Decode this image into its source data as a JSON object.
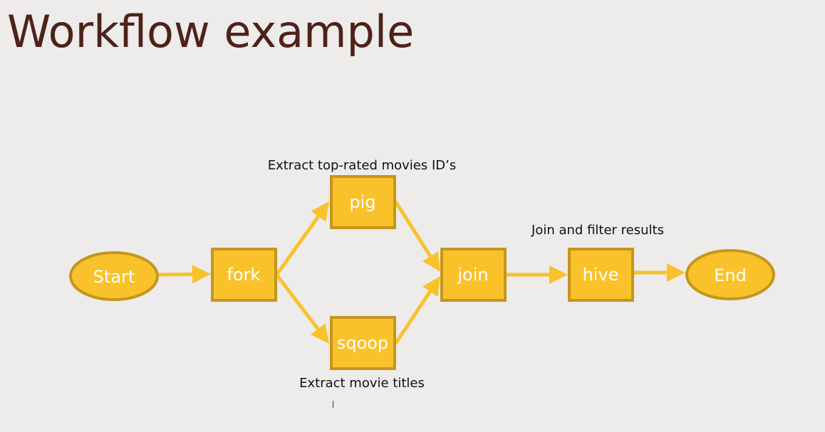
{
  "title": "Workflow example",
  "colors": {
    "node_fill": "#f9c22a",
    "node_stroke": "#c4961e",
    "edge": "#f9c22a",
    "title": "#4e2219",
    "annotation": "#111111",
    "node_text": "#ffffff"
  },
  "nodes": [
    {
      "id": "start",
      "label": "Start",
      "shape": "ellipse"
    },
    {
      "id": "fork",
      "label": "fork",
      "shape": "box"
    },
    {
      "id": "pig",
      "label": "pig",
      "shape": "box"
    },
    {
      "id": "sqoop",
      "label": "sqoop",
      "shape": "box"
    },
    {
      "id": "join",
      "label": "join",
      "shape": "box"
    },
    {
      "id": "hive",
      "label": "hive",
      "shape": "box"
    },
    {
      "id": "end",
      "label": "End",
      "shape": "ellipse"
    }
  ],
  "edges": [
    {
      "from": "start",
      "to": "fork"
    },
    {
      "from": "fork",
      "to": "pig"
    },
    {
      "from": "fork",
      "to": "sqoop"
    },
    {
      "from": "pig",
      "to": "join"
    },
    {
      "from": "sqoop",
      "to": "join"
    },
    {
      "from": "join",
      "to": "hive"
    },
    {
      "from": "hive",
      "to": "end"
    }
  ],
  "annotations": {
    "pig": "Extract top-rated movies ID’s",
    "sqoop": "Extract movie titles",
    "hive": "Join and filter results"
  }
}
